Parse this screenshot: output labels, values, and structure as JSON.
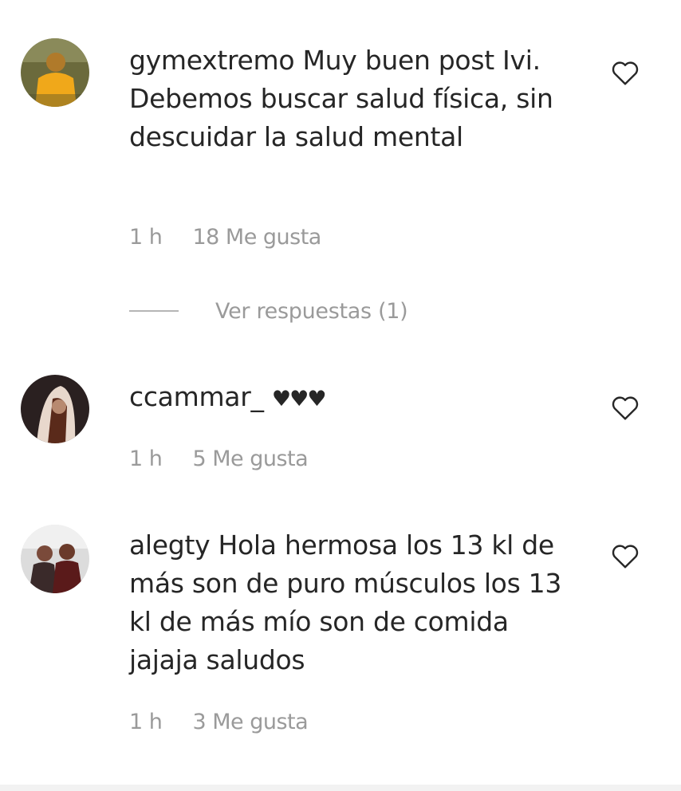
{
  "comments": [
    {
      "username": "gymextremo",
      "text": "Muy buen post Ivi. Debemos buscar salud física, sin descuidar la salud mental",
      "time": "1 h",
      "likes": "18 Me gusta",
      "replies_label": "Ver respuestas (1)"
    },
    {
      "username": "ccammar_",
      "text": "",
      "emoji": "♥♥♥",
      "time": "1 h",
      "likes": "5 Me gusta"
    },
    {
      "username": "alegty",
      "text": "Hola hermosa los 13 kl de más son de puro músculos los 13 kl de más mío son de comida jajaja saludos",
      "time": "1 h",
      "likes": "3 Me gusta"
    }
  ],
  "colors": {
    "text": "#262626",
    "meta": "#9a9a9a",
    "background": "#ffffff"
  },
  "icons": {
    "like": "heart-outline-icon"
  }
}
